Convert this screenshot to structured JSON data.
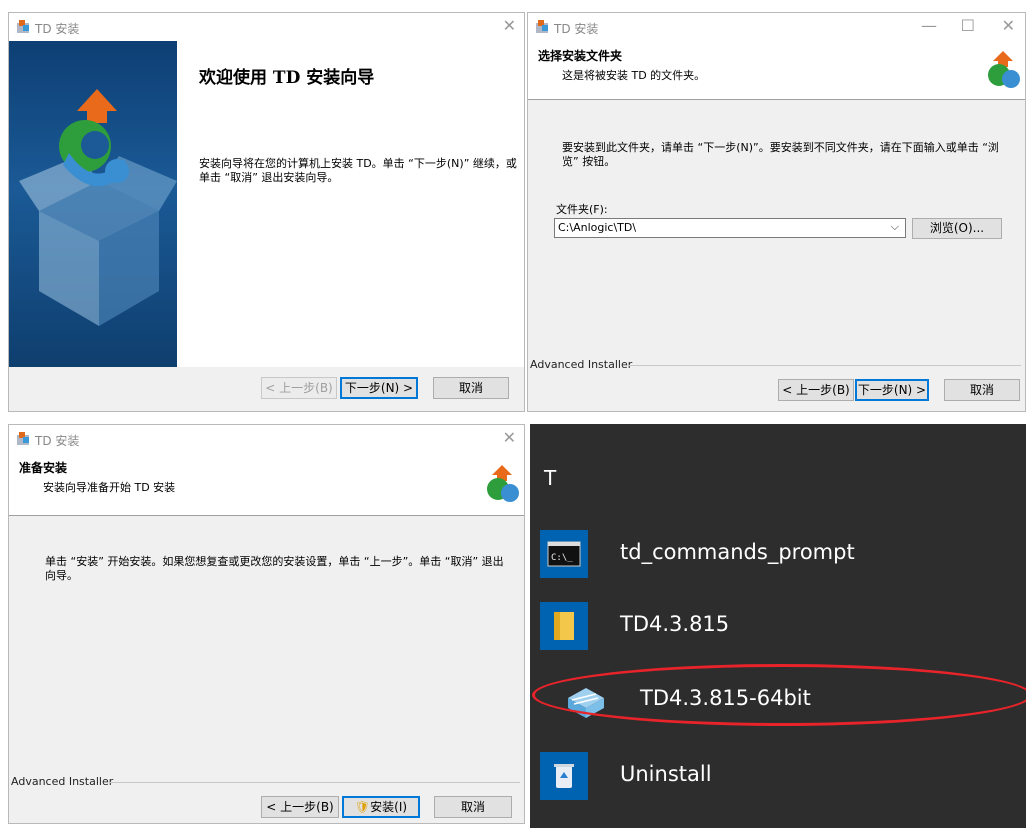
{
  "welcome": {
    "title": "TD 安装",
    "heading": "欢迎使用 TD 安装向导",
    "body": "安装向导将在您的计算机上安装 TD。单击 “下一步(N)” 继续，或单击 “取消” 退出安装向导。",
    "back_label": "< 上一步(B)",
    "next_label": "下一步(N) >",
    "cancel_label": "取消"
  },
  "folder": {
    "title": "TD 安装",
    "header_title": "选择安装文件夹",
    "header_sub": "这是将被安装 TD 的文件夹。",
    "body": "要安装到此文件夹，请单击 “下一步(N)”。要安装到不同文件夹，请在下面输入或单击 “浏览” 按钮。",
    "field_label": "文件夹(F):",
    "field_value": "C:\\Anlogic\\TD\\",
    "browse_label": "浏览(O)...",
    "footer": "Advanced Installer",
    "back_label": "< 上一步(B)",
    "next_label": "下一步(N) >",
    "cancel_label": "取消"
  },
  "ready": {
    "title": "TD 安装",
    "header_title": "准备安装",
    "header_sub": "安装向导准备开始 TD 安装",
    "body": "单击 “安装” 开始安装。如果您想复查或更改您的安装设置，单击 “上一步”。单击 “取消” 退出向导。",
    "footer": "Advanced Installer",
    "back_label": "< 上一步(B)",
    "install_label": "安装(I)",
    "cancel_label": "取消"
  },
  "start_menu": {
    "group_letter": "T",
    "items": [
      {
        "label": "td_commands_prompt",
        "icon": "cmd-icon"
      },
      {
        "label": "TD4.3.815",
        "icon": "folder-icon"
      },
      {
        "label": "TD4.3.815-64bit",
        "icon": "app-icon"
      },
      {
        "label": "Uninstall",
        "icon": "recycle-bin-icon"
      }
    ],
    "highlight_color": "#e8232a",
    "tile_color": "#0063b1"
  }
}
